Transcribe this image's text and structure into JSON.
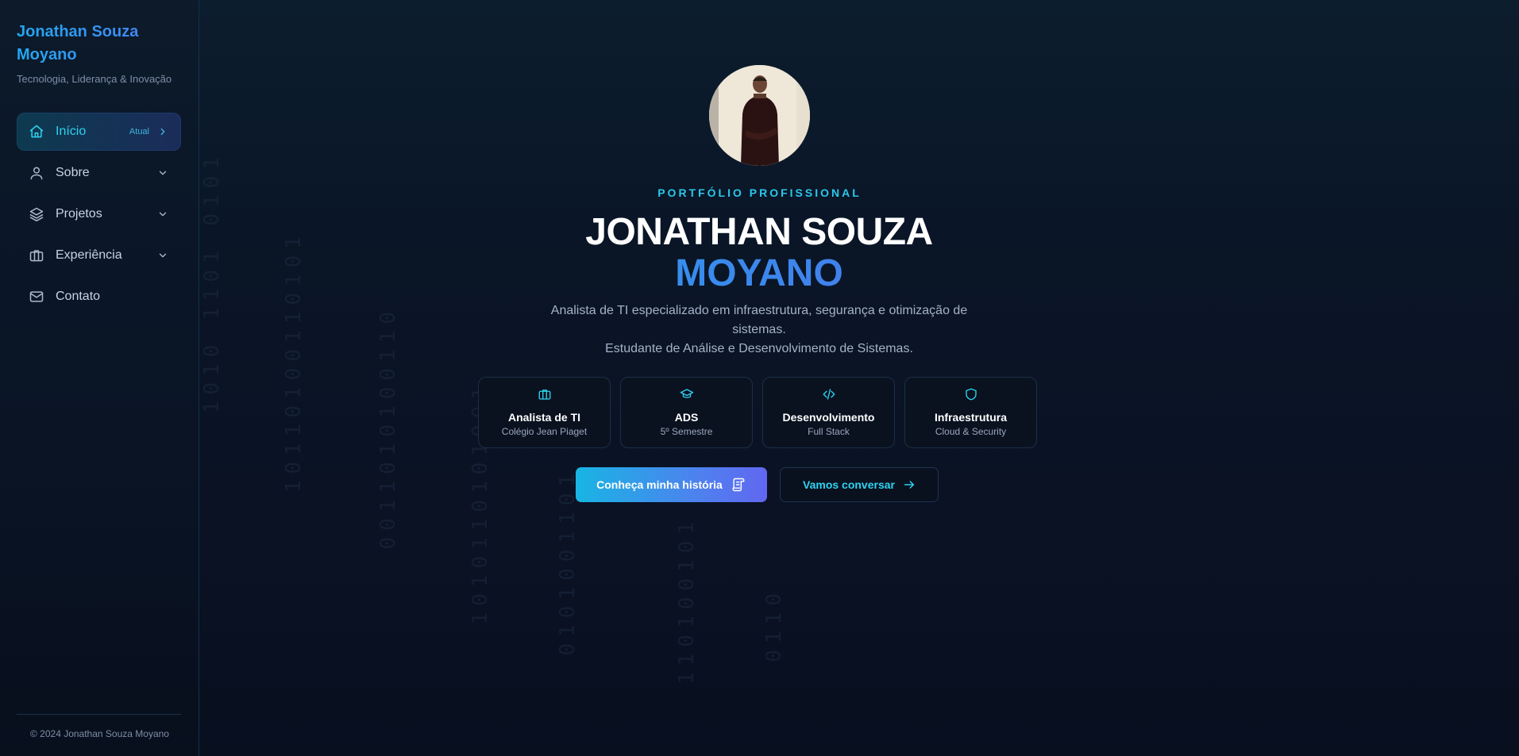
{
  "sidebar": {
    "brand_title": "Jonathan Souza Moyano",
    "brand_subtitle": "Tecnologia, Liderança & Inovação",
    "items": [
      {
        "label": "Início",
        "icon": "home-icon",
        "badge": "Atual",
        "active": true
      },
      {
        "label": "Sobre",
        "icon": "user-icon"
      },
      {
        "label": "Projetos",
        "icon": "layers-icon"
      },
      {
        "label": "Experiência",
        "icon": "briefcase-icon"
      },
      {
        "label": "Contato",
        "icon": "mail-icon"
      }
    ],
    "copyright": "© 2024 Jonathan Souza Moyano"
  },
  "hero": {
    "eyebrow": "PORTFÓLIO PROFISSIONAL",
    "name_line1": "JONATHAN SOUZA",
    "name_line2": "MOYANO",
    "description_line1": "Analista de TI especializado em infraestrutura, segurança e otimização de sistemas.",
    "description_line2": "Estudante de Análise e Desenvolvimento de Sistemas.",
    "cards": [
      {
        "icon": "briefcase-icon",
        "title": "Analista de TI",
        "subtitle": "Colégio Jean Piaget"
      },
      {
        "icon": "graduation-cap-icon",
        "title": "ADS",
        "subtitle": "5º Semestre"
      },
      {
        "icon": "code-icon",
        "title": "Desenvolvimento",
        "subtitle": "Full Stack"
      },
      {
        "icon": "shield-icon",
        "title": "Infraestrutura",
        "subtitle": "Cloud & Security"
      }
    ],
    "primary_button": "Conheça minha história",
    "secondary_button": "Vamos conversar"
  },
  "colors": {
    "accent_cyan": "#2ed3f0",
    "accent_blue": "#3d8bf0",
    "background": "#0a1526"
  }
}
